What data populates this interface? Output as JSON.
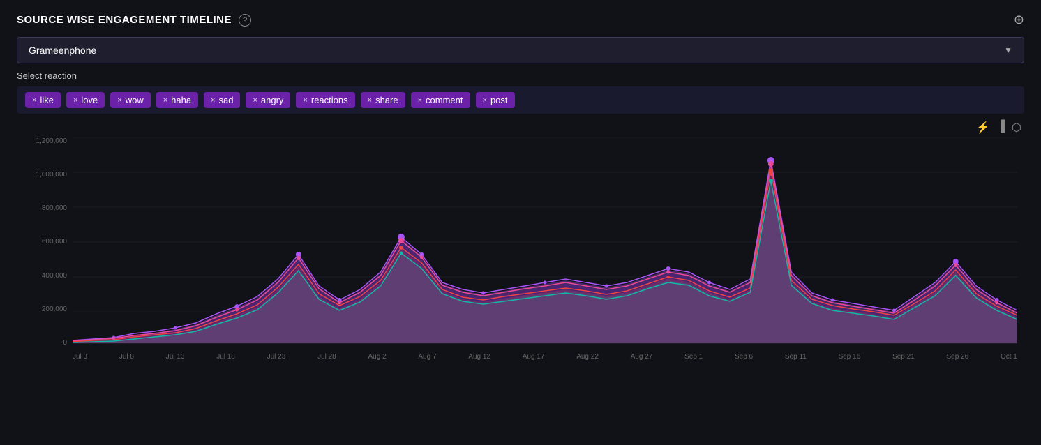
{
  "header": {
    "title": "SOURCE WISE ENGAGEMENT TIMELINE",
    "help_tooltip": "?",
    "zoom_icon": "⊕"
  },
  "dropdown": {
    "value": "Grameenphone",
    "arrow": "▼"
  },
  "reaction_label": "Select reaction",
  "tags": [
    {
      "label": "like",
      "id": "tag-like"
    },
    {
      "label": "love",
      "id": "tag-love"
    },
    {
      "label": "wow",
      "id": "tag-wow"
    },
    {
      "label": "haha",
      "id": "tag-haha"
    },
    {
      "label": "sad",
      "id": "tag-sad"
    },
    {
      "label": "angry",
      "id": "tag-angry"
    },
    {
      "label": "reactions",
      "id": "tag-reactions"
    },
    {
      "label": "share",
      "id": "tag-share"
    },
    {
      "label": "comment",
      "id": "tag-comment"
    },
    {
      "label": "post",
      "id": "tag-post"
    }
  ],
  "chart_controls": [
    {
      "icon": "📈",
      "name": "line-chart-icon"
    },
    {
      "icon": "📊",
      "name": "bar-chart-icon"
    },
    {
      "icon": "⬡",
      "name": "stack-chart-icon"
    }
  ],
  "y_axis": [
    "1,200,000",
    "1,000,000",
    "800,000",
    "600,000",
    "400,000",
    "200,000",
    "0"
  ],
  "x_axis": [
    "Jul 3",
    "Jul 8",
    "Jul 13",
    "Jul 18",
    "Jul 23",
    "Jul 28",
    "Aug 2",
    "Aug 7",
    "Aug 12",
    "Aug 17",
    "Aug 22",
    "Aug 27",
    "Sep 1",
    "Sep 6",
    "Sep 11",
    "Sep 16",
    "Sep 21",
    "Sep 26",
    "Oct 1"
  ],
  "colors": {
    "background": "#111118",
    "tag_bg": "#6b21a8",
    "accent_purple": "#a855f7",
    "accent_pink": "#ec4899",
    "accent_red": "#ef4444",
    "accent_teal": "#14b8a6",
    "accent_orange": "#f97316"
  }
}
